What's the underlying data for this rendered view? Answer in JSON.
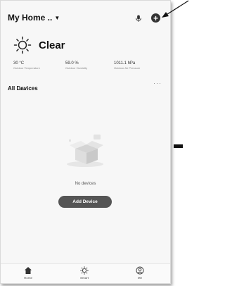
{
  "header": {
    "home_name": "My Home ..",
    "chevron_icon": "chevron-down-icon",
    "mic_icon": "mic-icon",
    "add_icon": "plus-circle-icon"
  },
  "weather": {
    "icon": "sun-icon",
    "condition": "Clear",
    "stats": [
      {
        "value": "30 °C",
        "label": "Outdoor Temperature"
      },
      {
        "value": "59.0 %",
        "label": "Outdoor Humidity"
      },
      {
        "value": "1011.1 hPa",
        "label": "Outdoor Air Pressure"
      }
    ]
  },
  "devices": {
    "section_title": "All Devices",
    "more_label": "···",
    "empty_text": "No devices",
    "add_button_label": "Add Device"
  },
  "tabs": [
    {
      "label": "Home",
      "icon": "home-icon"
    },
    {
      "label": "Smart",
      "icon": "smart-sun-icon"
    },
    {
      "label": "Me",
      "icon": "profile-icon"
    }
  ],
  "colors": {
    "screen_bg": "#f7f7f7",
    "button_bg": "#555555",
    "text_dark": "#111111"
  }
}
